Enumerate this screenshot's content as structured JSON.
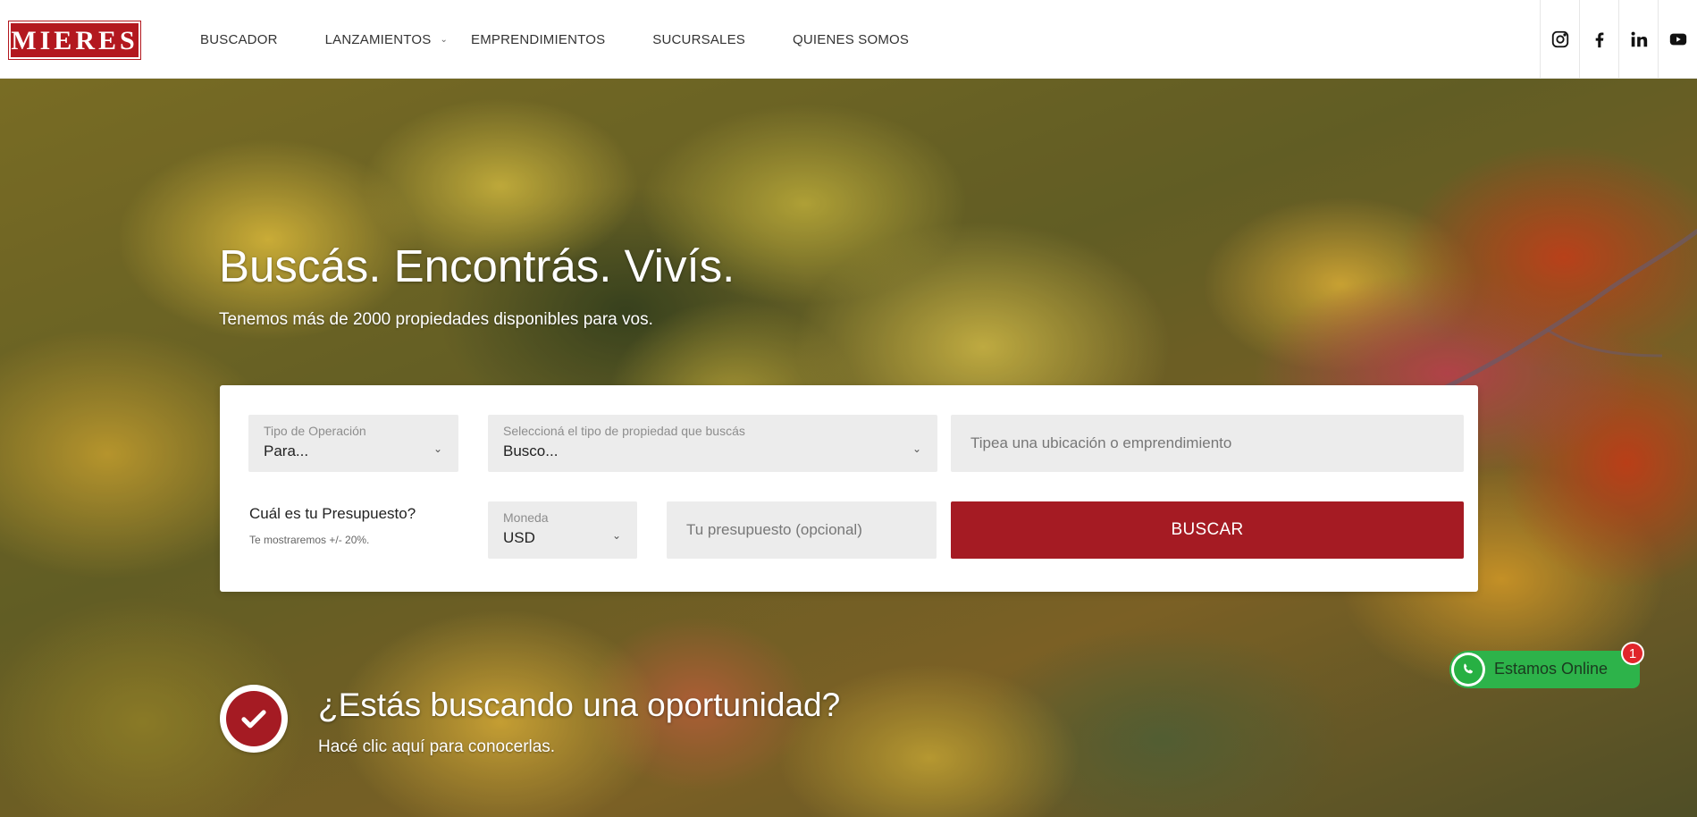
{
  "brand": {
    "logo_text": "MIERES",
    "primary_color": "#a51b23"
  },
  "nav": {
    "items": [
      {
        "label": "BUSCADOR",
        "has_dropdown": false
      },
      {
        "label": "LANZAMIENTOS",
        "has_dropdown": true
      },
      {
        "label": "EMPRENDIMIENTOS",
        "has_dropdown": false
      },
      {
        "label": "SUCURSALES",
        "has_dropdown": false
      },
      {
        "label": "QUIENES SOMOS",
        "has_dropdown": false
      }
    ]
  },
  "socials": [
    "instagram-icon",
    "facebook-icon",
    "linkedin-icon",
    "youtube-icon"
  ],
  "hero": {
    "headline": "Buscás. Encontrás. Vivís.",
    "subhead": "Tenemos más de 2000 propiedades disponibles para vos."
  },
  "search": {
    "operation": {
      "label": "Tipo de Operación",
      "value": "Para..."
    },
    "property_type": {
      "label": "Seleccioná el tipo de propiedad que buscás",
      "value": "Busco..."
    },
    "location": {
      "placeholder": "Tipea una ubicación o emprendimiento"
    },
    "budget_title": "Cuál es tu Presupuesto?",
    "budget_note": "Te mostraremos +/- 20%.",
    "currency": {
      "label": "Moneda",
      "value": "USD"
    },
    "budget": {
      "placeholder": "Tu presupuesto (opcional)"
    },
    "submit_label": "BUSCAR"
  },
  "opportunity": {
    "title": "¿Estás buscando una oportunidad?",
    "subtitle": "Hacé clic aquí para conocerlas."
  },
  "whatsapp": {
    "label": "Estamos Online",
    "badge": "1",
    "color": "#2db34a"
  }
}
